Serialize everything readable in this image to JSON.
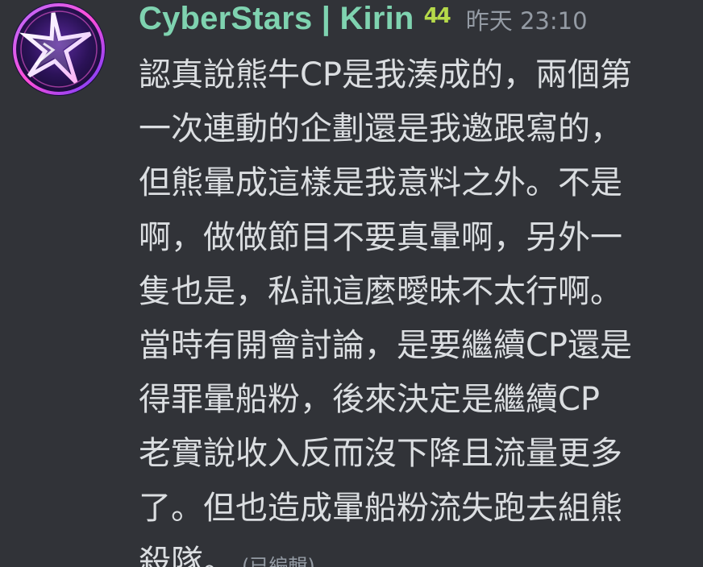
{
  "author": {
    "name": "CyberStars | Kirin",
    "badge": "44",
    "timestamp": "昨天 23:10"
  },
  "message": {
    "lines": [
      "認真說熊牛CP是我湊成的，兩個第",
      "一次連動的企劃還是我邀跟寫的，",
      "但熊暈成這樣是我意料之外。不是",
      "啊，做做節目不要真暈啊，另外一",
      "隻也是，私訊這麼曖昧不太行啊。",
      "當時有開會討論，是要繼續CP還是",
      "得罪暈船粉，後來決定是繼續CP",
      "老實說收入反而沒下降且流量更多",
      "了。但也造成暈船粉流失跑去組熊",
      "殺隊。"
    ],
    "edited_label": "(已編輯)"
  },
  "colors": {
    "background": "#313338",
    "username": "#7fd3b0",
    "badge": "#b5d94a",
    "text": "#dbdee1",
    "muted": "#949ba4"
  },
  "icons": {
    "avatar": "cyberstars-star-logo"
  }
}
